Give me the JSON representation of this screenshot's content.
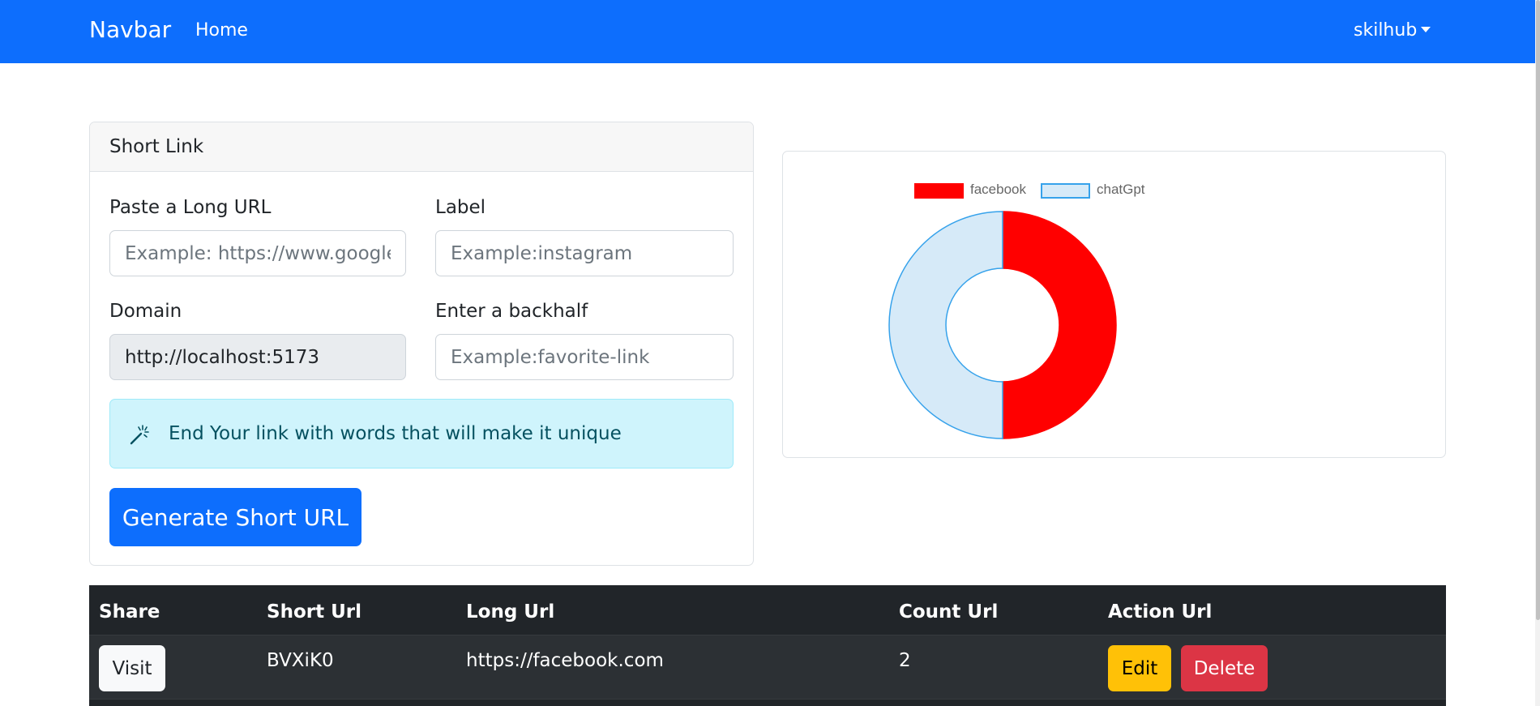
{
  "navbar": {
    "brand": "Navbar",
    "home": "Home",
    "user": "skilhub",
    "color": "#0d6efd"
  },
  "form": {
    "title": "Short Link",
    "long_url": {
      "label": "Paste a Long URL",
      "placeholder": "Example: https://www.google.com"
    },
    "label_field": {
      "label": "Label",
      "placeholder": "Example:instagram"
    },
    "domain": {
      "label": "Domain",
      "value": "http://localhost:5173"
    },
    "backhalf": {
      "label": "Enter a backhalf",
      "placeholder": "Example:favorite-link"
    },
    "tip": {
      "icon": "magic-wand-icon",
      "text": "End Your link with words that will make it unique"
    },
    "submit_label": "Generate Short URL"
  },
  "chart_data": {
    "type": "doughnut",
    "categories": [
      "facebook",
      "chatGpt"
    ],
    "values": [
      50,
      50
    ],
    "colors": [
      "#ff0000",
      "#d6eaf8"
    ],
    "border_colors": [
      "#ff0000",
      "#36a2eb"
    ],
    "legend": "top"
  },
  "table": {
    "headers": [
      "Share",
      "Short Url",
      "Long Url",
      "Count Url",
      "Action Url"
    ],
    "rows": [
      {
        "share": "Visit",
        "short": "BVXiK0",
        "long": "https://facebook.com",
        "count": "2",
        "edit": "Edit",
        "delete": "Delete"
      }
    ]
  }
}
